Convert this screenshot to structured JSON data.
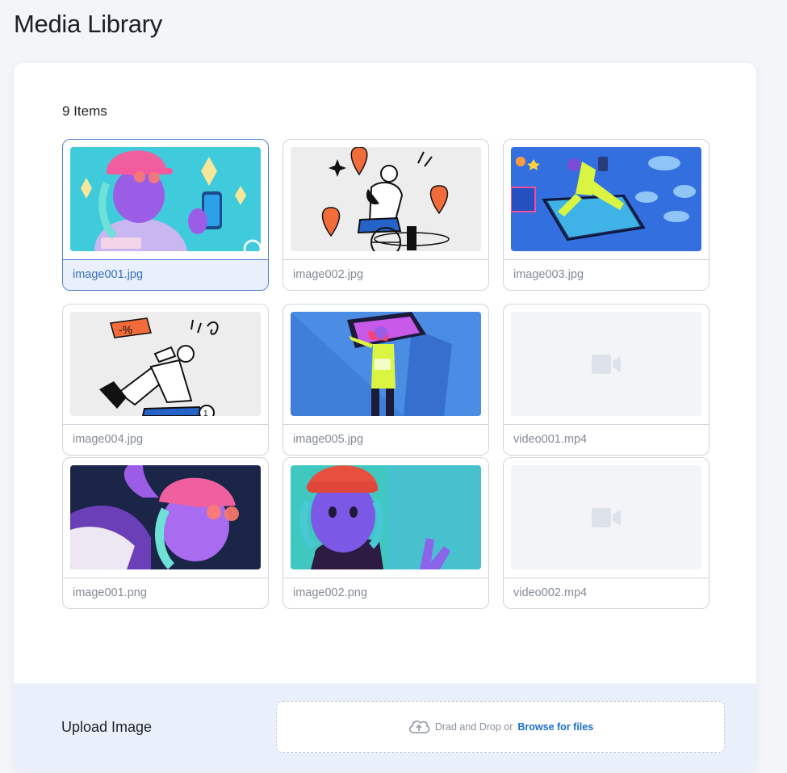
{
  "page": {
    "title": "Media Library"
  },
  "library": {
    "count_label": "9 Items",
    "items": [
      {
        "name": "image001.jpg",
        "kind": "image",
        "selected": true
      },
      {
        "name": "image002.jpg",
        "kind": "image",
        "selected": false
      },
      {
        "name": "image003.jpg",
        "kind": "image",
        "selected": false
      },
      {
        "name": "image004.jpg",
        "kind": "image",
        "selected": false
      },
      {
        "name": "image005.jpg",
        "kind": "image",
        "selected": false
      },
      {
        "name": "video001.mp4",
        "kind": "video",
        "selected": false
      },
      {
        "name": "image001.png",
        "kind": "image",
        "selected": false
      },
      {
        "name": "image002.png",
        "kind": "image",
        "selected": false
      },
      {
        "name": "video002.mp4",
        "kind": "video",
        "selected": false
      }
    ]
  },
  "upload": {
    "label": "Upload Image",
    "drop_text": "Drad and Drop or",
    "browse_label": "Browse for files",
    "icon": "cloud-upload-icon"
  },
  "colors": {
    "accent": "#1a6fc9",
    "selected_border": "#4b7fcf",
    "selected_bg": "#e9f0fc",
    "upload_bar_bg": "#eaf0fb"
  }
}
